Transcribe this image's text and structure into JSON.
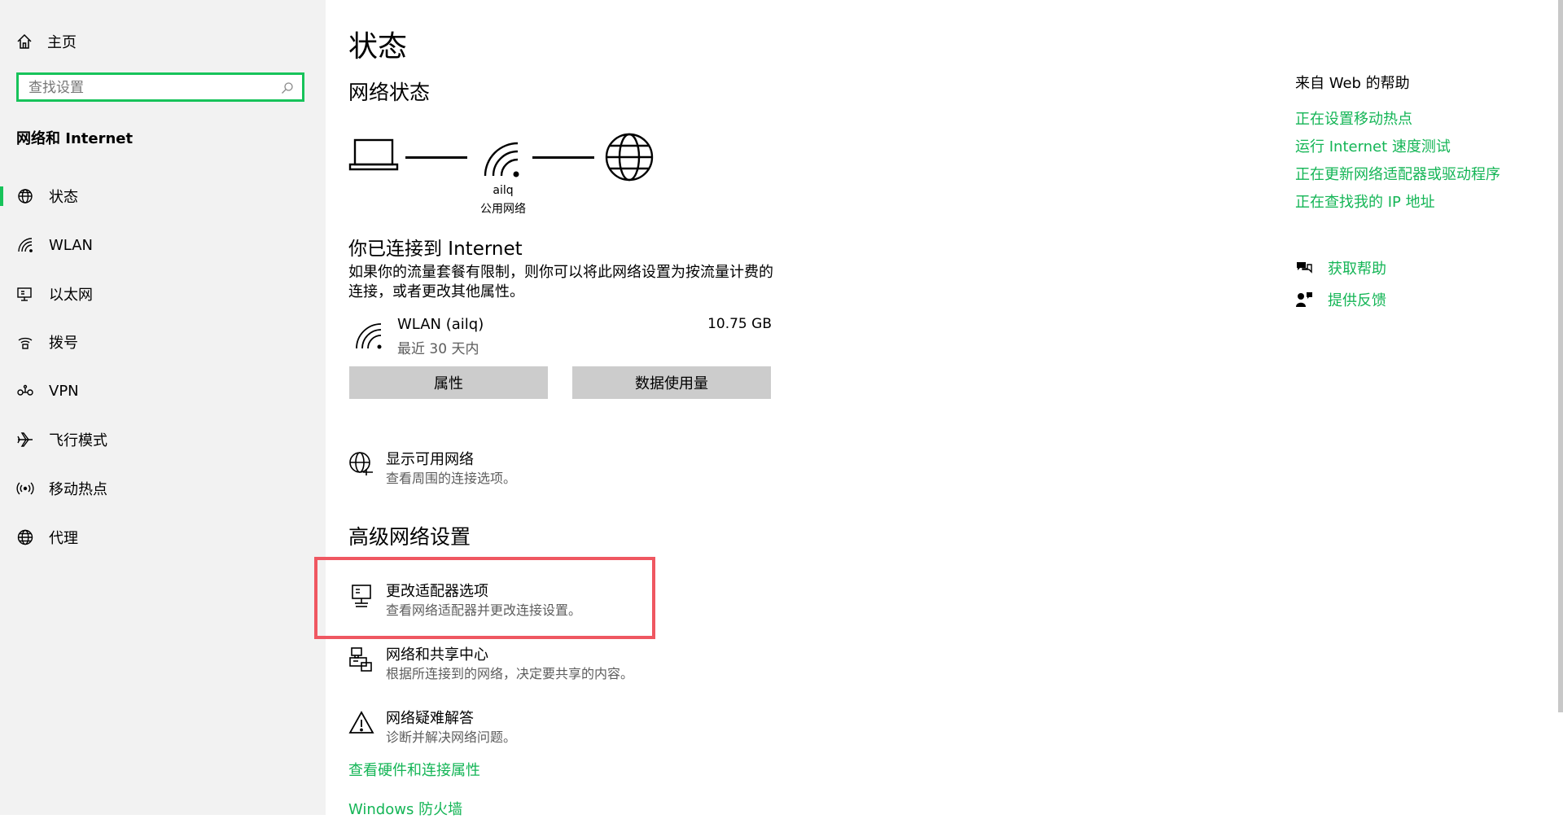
{
  "sidebar": {
    "home_label": "主页",
    "search_placeholder": "查找设置",
    "section_title": "网络和 Internet",
    "items": [
      {
        "label": "状态",
        "icon": "globe-status-icon",
        "active": true
      },
      {
        "label": "WLAN",
        "icon": "wifi-icon",
        "active": false
      },
      {
        "label": "以太网",
        "icon": "ethernet-icon",
        "active": false
      },
      {
        "label": "拨号",
        "icon": "dialup-icon",
        "active": false
      },
      {
        "label": "VPN",
        "icon": "vpn-icon",
        "active": false
      },
      {
        "label": "飞行模式",
        "icon": "airplane-icon",
        "active": false
      },
      {
        "label": "移动热点",
        "icon": "hotspot-icon",
        "active": false
      },
      {
        "label": "代理",
        "icon": "globe-icon",
        "active": false
      }
    ]
  },
  "main": {
    "title": "状态",
    "network_status_heading": "网络状态",
    "diagram": {
      "ssid": "ailq",
      "network_type": "公用网络"
    },
    "connected_heading": "你已连接到 Internet",
    "connected_desc_line1": "如果你的流量套餐有限制，则你可以将此网络设置为按流量计费的",
    "connected_desc_line2": "连接，或者更改其他属性。",
    "connection": {
      "name": "WLAN (ailq)",
      "period": "最近 30 天内",
      "usage": "10.75 GB"
    },
    "buttons": {
      "properties": "属性",
      "data_usage": "数据使用量"
    },
    "show_networks": {
      "title": "显示可用网络",
      "desc": "查看周围的连接选项。"
    },
    "advanced_heading": "高级网络设置",
    "advanced_items": [
      {
        "title": "更改适配器选项",
        "desc": "查看网络适配器并更改连接设置。",
        "icon": "adapter-icon"
      },
      {
        "title": "网络和共享中心",
        "desc": "根据所连接到的网络，决定要共享的内容。",
        "icon": "sharing-center-icon"
      },
      {
        "title": "网络疑难解答",
        "desc": "诊断并解决网络问题。",
        "icon": "warning-icon"
      }
    ],
    "links": {
      "hardware": "查看硬件和连接属性",
      "firewall": "Windows 防火墙"
    }
  },
  "help": {
    "heading": "来自 Web 的帮助",
    "links": [
      "正在设置移动热点",
      "运行 Internet 速度测试",
      "正在更新网络适配器或驱动程序",
      "正在查找我的 IP 地址"
    ],
    "get_help": "获取帮助",
    "feedback": "提供反馈"
  },
  "colors": {
    "accent": "#14b556",
    "search_border": "#17c35a",
    "highlight": "#ef5761",
    "button_bg": "#cccccc"
  }
}
